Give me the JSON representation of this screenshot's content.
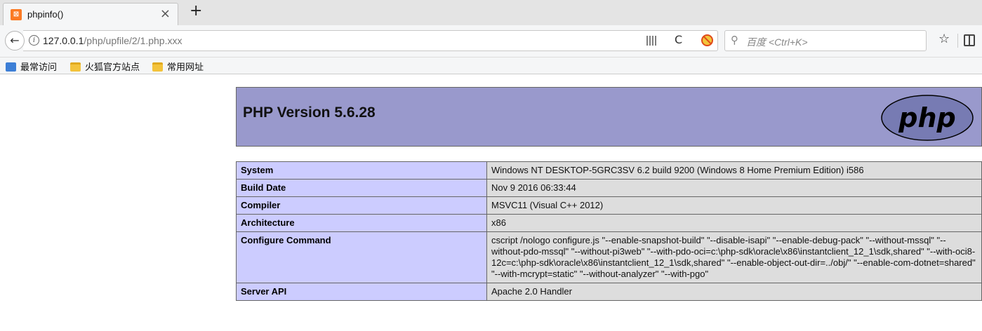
{
  "browser": {
    "tab_title": "phpinfo()",
    "tab_favicon_glyph": "⊠",
    "tab_close": "×",
    "new_tab": "+",
    "url_host": "127.0.0.1",
    "url_rest": "/php/upfile/2/1.php.xxx",
    "search_placeholder": "百度 <Ctrl+K>",
    "icons": [
      "back-arrow-icon",
      "info-icon",
      "qr-code-icon",
      "reload-icon",
      "block-icon",
      "search-icon",
      "bookmark-star-icon",
      "reading-list-icon"
    ]
  },
  "bookmarks": [
    {
      "label": "最常访问",
      "icon": "blue"
    },
    {
      "label": "火狐官方站点",
      "icon": "folder"
    },
    {
      "label": "常用网址",
      "icon": "folder"
    }
  ],
  "php": {
    "title": "PHP Version 5.6.28",
    "logo_text": "php",
    "rows": [
      {
        "key": "System",
        "value": "Windows NT DESKTOP-5GRC3SV 6.2 build 9200 (Windows 8 Home Premium Edition) i586"
      },
      {
        "key": "Build Date",
        "value": "Nov 9 2016 06:33:44"
      },
      {
        "key": "Compiler",
        "value": "MSVC11 (Visual C++ 2012)"
      },
      {
        "key": "Architecture",
        "value": "x86"
      },
      {
        "key": "Configure Command",
        "value": "cscript /nologo configure.js \"--enable-snapshot-build\" \"--disable-isapi\" \"--enable-debug-pack\" \"--without-mssql\" \"--without-pdo-mssql\" \"--without-pi3web\" \"--with-pdo-oci=c:\\php-sdk\\oracle\\x86\\instantclient_12_1\\sdk,shared\" \"--with-oci8-12c=c:\\php-sdk\\oracle\\x86\\instantclient_12_1\\sdk,shared\" \"--enable-object-out-dir=../obj/\" \"--enable-com-dotnet=shared\" \"--with-mcrypt=static\" \"--without-analyzer\" \"--with-pgo\""
      },
      {
        "key": "Server API",
        "value": "Apache 2.0 Handler"
      }
    ]
  },
  "colors": {
    "php_header": "#9999cc",
    "key_cell": "#ccccff",
    "value_cell": "#dddddd",
    "logo_fill": "#777bb3"
  }
}
